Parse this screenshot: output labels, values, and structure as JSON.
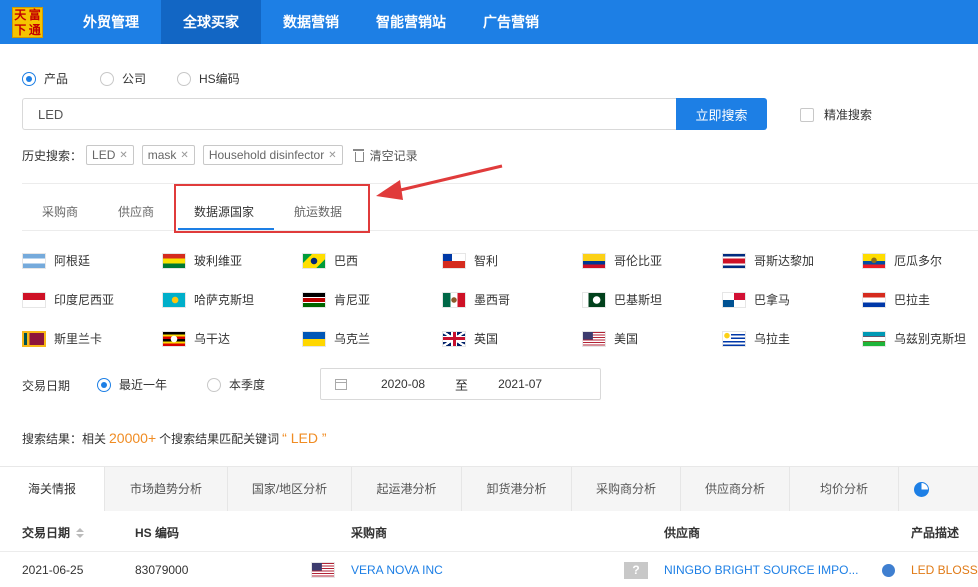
{
  "logo": {
    "chars": [
      "天",
      "富",
      "下",
      "通"
    ]
  },
  "nav": [
    {
      "label": "外贸管理"
    },
    {
      "label": "全球买家"
    },
    {
      "label": "数据营销"
    },
    {
      "label": "智能营销站"
    },
    {
      "label": "广告营销"
    }
  ],
  "search_type": {
    "options": [
      "产品",
      "公司",
      "HS编码"
    ],
    "selected": "产品"
  },
  "search": {
    "value": "LED",
    "button": "立即搜索",
    "exact_label": "精准搜索"
  },
  "history": {
    "label": "历史搜索：",
    "tags": [
      "LED",
      "mask",
      "Household disinfector"
    ],
    "clear_label": "清空记录"
  },
  "subtabs": [
    "采购商",
    "供应商",
    "数据源国家",
    "航运数据"
  ],
  "countries": [
    {
      "name": "阿根廷",
      "flag": "argentina-flag"
    },
    {
      "name": "玻利维亚",
      "flag": "bolivia-flag"
    },
    {
      "name": "巴西",
      "flag": "brazil-flag"
    },
    {
      "name": "智利",
      "flag": "chile-flag"
    },
    {
      "name": "哥伦比亚",
      "flag": "colombia-flag"
    },
    {
      "name": "哥斯达黎加",
      "flag": "costa-rica-flag"
    },
    {
      "name": "厄瓜多尔",
      "flag": "ecuador-flag"
    },
    {
      "name": "印度尼西亚",
      "flag": "indonesia-flag"
    },
    {
      "name": "哈萨克斯坦",
      "flag": "kazakhstan-flag"
    },
    {
      "name": "肯尼亚",
      "flag": "kenya-flag"
    },
    {
      "name": "墨西哥",
      "flag": "mexico-flag"
    },
    {
      "name": "巴基斯坦",
      "flag": "pakistan-flag"
    },
    {
      "name": "巴拿马",
      "flag": "panama-flag"
    },
    {
      "name": "巴拉圭",
      "flag": "paraguay-flag"
    },
    {
      "name": "斯里兰卡",
      "flag": "sri-lanka-flag"
    },
    {
      "name": "乌干达",
      "flag": "uganda-flag"
    },
    {
      "name": "乌克兰",
      "flag": "ukraine-flag"
    },
    {
      "name": "英国",
      "flag": "uk-flag"
    },
    {
      "name": "美国",
      "flag": "usa-flag"
    },
    {
      "name": "乌拉圭",
      "flag": "uruguay-flag"
    },
    {
      "name": "乌兹别克斯坦",
      "flag": "uzbekistan-flag"
    }
  ],
  "trade_date": {
    "label": "交易日期",
    "options": [
      "最近一年",
      "本季度"
    ],
    "selected": "最近一年",
    "start": "2020-08",
    "sep": "至",
    "end": "2021-07"
  },
  "results": {
    "prefix": "搜索结果：相关",
    "count": "20000+",
    "middle": "个搜索结果匹配关键词",
    "keyword": "“ LED ”"
  },
  "analysis_tabs": [
    "海关情报",
    "市场趋势分析",
    "国家/地区分析",
    "起运港分析",
    "卸货港分析",
    "采购商分析",
    "供应商分析",
    "均价分析"
  ],
  "table": {
    "headers": [
      "交易日期",
      "HS 编码",
      "采购商",
      "供应商",
      "产品描述"
    ],
    "rows": [
      {
        "date": "2021-06-25",
        "hs": "83079000",
        "buyer": "VERA NOVA INC",
        "supplier": "NINGBO BRIGHT SOURCE IMPO...",
        "product": "LED BLOSSO"
      }
    ]
  },
  "colors": {
    "primary": "#1d7fe5",
    "nav_active": "#1266c4",
    "accent": "#f08c23",
    "annotation": "#e03b3b"
  }
}
